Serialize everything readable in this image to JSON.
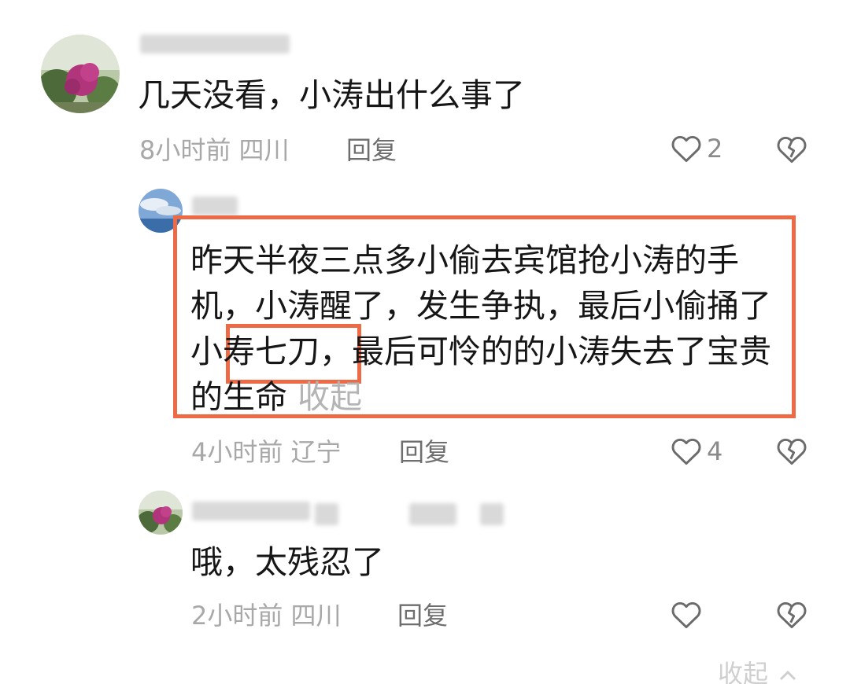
{
  "comments": [
    {
      "text": "几天没看，小涛出什么事了",
      "time_location": "8小时前 四川",
      "reply_label": "回复",
      "like_count": "2"
    },
    {
      "lines": [
        "昨天半夜三点多小偷去宾馆抢小涛的手",
        "机，小涛醒了，发生争执，最后小偷捅了",
        "小寿七刀，最后可怜的的小涛失去了宝贵",
        "的生命"
      ],
      "collapse_label": "收起",
      "time_location": "4小时前 辽宁",
      "reply_label": "回复",
      "like_count": "4"
    },
    {
      "text": "哦，太残忍了",
      "time_location": "2小时前 四川",
      "reply_label": "回复",
      "like_count": ""
    }
  ],
  "footer": {
    "collapse_label": "收起"
  },
  "colors": {
    "highlight": "#ec6a45",
    "meta": "#a8a8a8",
    "reply": "#6e6e6e"
  },
  "icons": [
    "heart-outline-icon",
    "broken-heart-icon"
  ]
}
